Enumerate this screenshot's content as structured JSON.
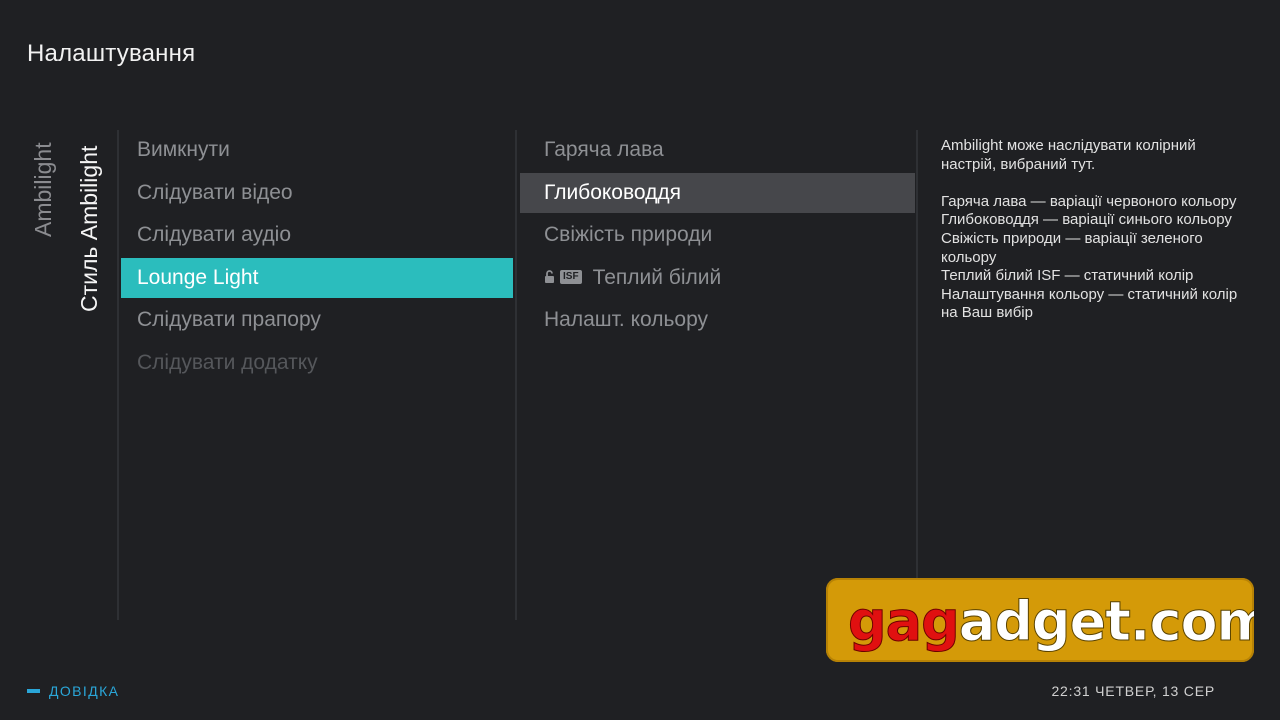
{
  "header": {
    "title": "Налаштування"
  },
  "breadcrumb": {
    "level1": "Ambilight",
    "level2": "Стиль Ambilight"
  },
  "styles_menu": {
    "items": [
      {
        "label": "Вимкнути",
        "state": "normal"
      },
      {
        "label": "Слідувати відео",
        "state": "normal"
      },
      {
        "label": "Слідувати аудіо",
        "state": "normal"
      },
      {
        "label": "Lounge Light",
        "state": "selected"
      },
      {
        "label": "Слідувати прапору",
        "state": "normal"
      },
      {
        "label": "Слідувати додатку",
        "state": "disabled"
      }
    ]
  },
  "lounge_menu": {
    "items": [
      {
        "label": "Гаряча лава",
        "state": "normal"
      },
      {
        "label": "Глибоководдя",
        "state": "focused"
      },
      {
        "label": "Свіжість природи",
        "state": "normal"
      },
      {
        "label": "Теплий білий",
        "state": "normal",
        "badge": "ISF",
        "icon": "lock-open-icon"
      },
      {
        "label": "Налашт. кольору",
        "state": "normal"
      }
    ]
  },
  "help_panel": {
    "intro": "Ambilight може наслідувати колірний настрій, вибраний тут.",
    "lines": [
      "Гаряча лава — варіації червоного кольору",
      "Глибоководдя — варіації синього кольору",
      "Свіжість природи — варіації зеленого кольору",
      "Теплий білий ISF — статичний колір",
      "Налаштування кольору — статичний колір на Ваш вибір"
    ]
  },
  "footer": {
    "help_label": "ДОВІДКА",
    "clock": "22:31 ЧЕТВЕР, 13 СЕР"
  },
  "watermark": {
    "text_red": "gag",
    "text_white": "adget.com"
  },
  "colors": {
    "background": "#1f2023",
    "selected": "#2bbdbd",
    "focused": "#46474b",
    "help_accent": "#2aa6d8",
    "watermark_bg": "#d49a08",
    "watermark_red": "#e01010"
  }
}
